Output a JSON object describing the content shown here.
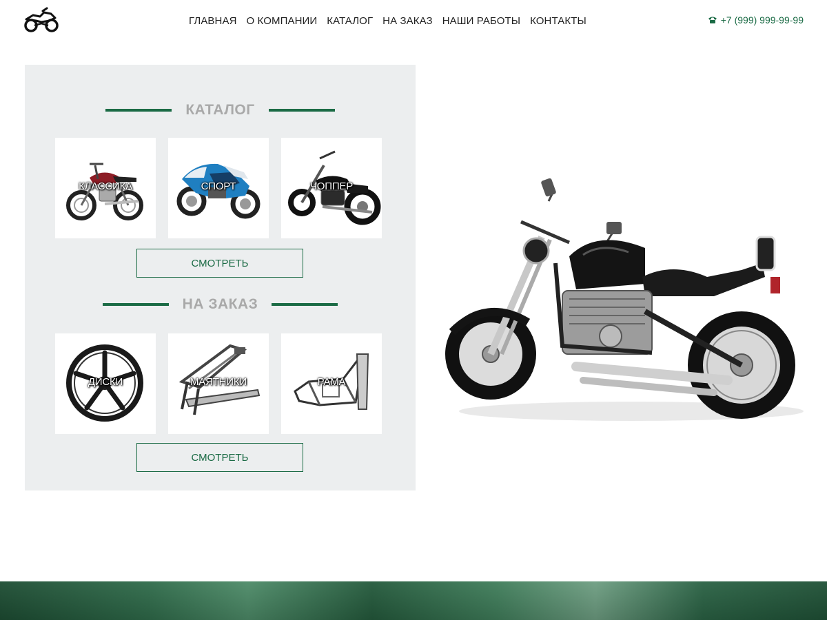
{
  "header": {
    "logo_icon": "motorcycle-icon",
    "nav": [
      {
        "label": "ГЛАВНАЯ"
      },
      {
        "label": "О КОМПАНИИ"
      },
      {
        "label": "КАТАЛОГ"
      },
      {
        "label": "НА ЗАКАЗ"
      },
      {
        "label": "НАШИ РАБОТЫ"
      },
      {
        "label": "КОНТАКТЫ"
      }
    ],
    "phone_icon": "phone-icon",
    "phone": "+7 (999) 999-99-99"
  },
  "catalog": {
    "title": "КАТАЛОГ",
    "items": [
      {
        "label": "КЛАССИКА",
        "icon": "classic-motorcycle-image"
      },
      {
        "label": "СПОРТ",
        "icon": "sport-motorcycle-image"
      },
      {
        "label": "ЧОППЕР",
        "icon": "chopper-motorcycle-image"
      }
    ],
    "button": "СМОТРЕТЬ"
  },
  "custom": {
    "title": "НА ЗАКАЗ",
    "items": [
      {
        "label": "ДИСКИ",
        "icon": "wheel-rim-image"
      },
      {
        "label": "МАЯТНИКИ",
        "icon": "swingarm-image"
      },
      {
        "label": "РАМА",
        "icon": "frame-image"
      }
    ],
    "button": "СМОТРЕТЬ"
  },
  "colors": {
    "accent": "#1b6b45",
    "panel_bg": "#eceeef",
    "title_gray": "#a9a9a9"
  }
}
